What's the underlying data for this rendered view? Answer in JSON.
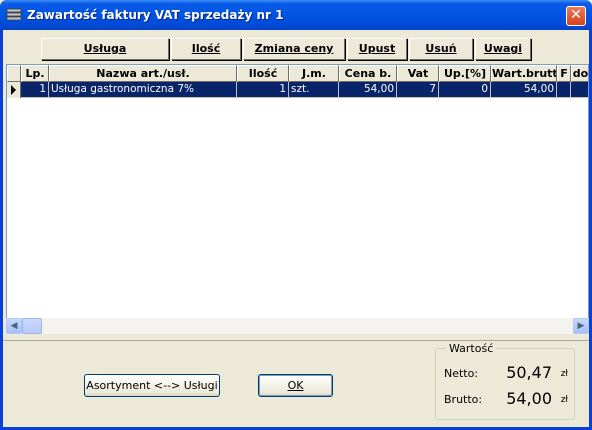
{
  "window": {
    "title": "Zawartość faktury VAT sprzedaży nr 1",
    "close_label": "✕"
  },
  "toolbar": {
    "usluga": "Usługa",
    "ilosc": "Ilość",
    "zmiana_ceny": "Zmiana ceny",
    "upust": "Upust",
    "usun": "Usuń",
    "uwagi": "Uwagi"
  },
  "grid": {
    "columns": [
      "Lp.",
      "Nazwa art./usł.",
      "Ilość",
      "J.m.",
      "Cena b.",
      "Vat",
      "Up.[%]",
      "Wart.brutto",
      "F",
      "do"
    ],
    "rows": [
      {
        "lp": "1",
        "nazwa": "Usługa gastronomiczna 7%",
        "ilosc": "1",
        "jm": "szt.",
        "cena": "54,00",
        "vat": "7",
        "upust": "0",
        "wartosc": "54,00",
        "f": "",
        "do": ""
      }
    ]
  },
  "scrollbar": {
    "left_arrow": "◀",
    "right_arrow": "▶"
  },
  "buttons": {
    "asortyment": "Asortyment <--> Usługi",
    "ok": "OK"
  },
  "wartosc": {
    "legend": "Wartość",
    "netto_label": "Netto:",
    "netto_value": "50,47",
    "netto_unit": "zł",
    "brutto_label": "Brutto:",
    "brutto_value": "54,00",
    "brutto_unit": "zł"
  }
}
